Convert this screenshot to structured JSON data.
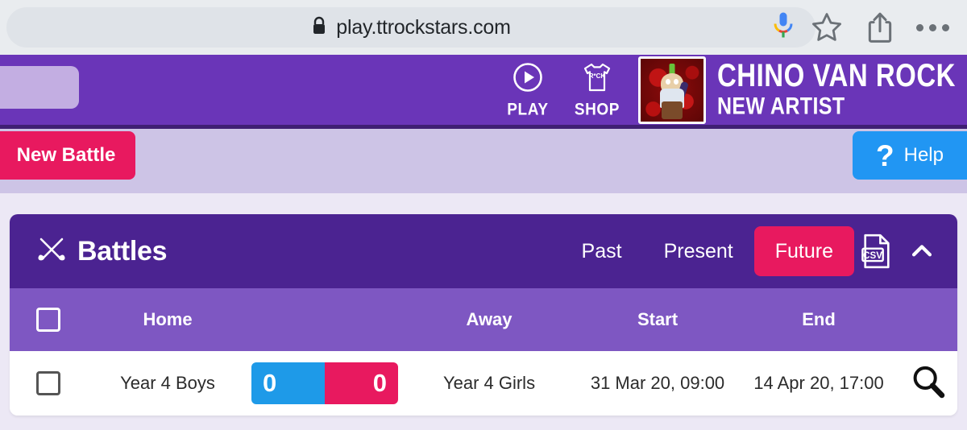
{
  "browser": {
    "url": "play.ttrockstars.com",
    "lock_icon": "lock-icon",
    "mic_icon": "google-mic-icon",
    "bookmark_icon": "star-icon",
    "share_icon": "share-icon",
    "menu_icon": "more-options-icon"
  },
  "topbar": {
    "nav": [
      {
        "label": "PLAY",
        "icon": "play-circle-icon"
      },
      {
        "label": "SHOP",
        "icon": "tshirt-icon"
      }
    ],
    "artist": {
      "name": "CHINO VAN ROCK",
      "subtitle": "NEW ARTIST",
      "avatar_icon": "rockstar-avatar"
    },
    "colors": {
      "background": "#6a35b8",
      "border": "#3f1f73"
    }
  },
  "action_bar": {
    "new_battle_label": "New Battle",
    "help_label": "Help",
    "help_icon": "question-mark-icon",
    "colors": {
      "background": "#cdc4e6",
      "new_battle": "#e8195f",
      "help": "#2196f3"
    }
  },
  "panel": {
    "title": "Battles",
    "title_icon": "crossed-guitars-icon",
    "tabs": [
      {
        "label": "Past",
        "active": false
      },
      {
        "label": "Present",
        "active": false
      },
      {
        "label": "Future",
        "active": true
      }
    ],
    "csv_icon": "csv-download-icon",
    "collapse_icon": "chevron-up-icon",
    "colors": {
      "header": "#4b2391",
      "table_header": "#7e57c2",
      "accent": "#e8195f"
    }
  },
  "table": {
    "columns": [
      "Home",
      "Away",
      "Start",
      "End"
    ],
    "rows": [
      {
        "home": "Year 4 Boys",
        "away": "Year 4 Girls",
        "home_score": "0",
        "away_score": "0",
        "start": "31 Mar 20, 09:00",
        "end": "14 Apr 20, 17:00",
        "view_icon": "magnifier-icon"
      }
    ],
    "score_colors": {
      "home": "#1e9ae8",
      "away": "#e8195f"
    }
  }
}
